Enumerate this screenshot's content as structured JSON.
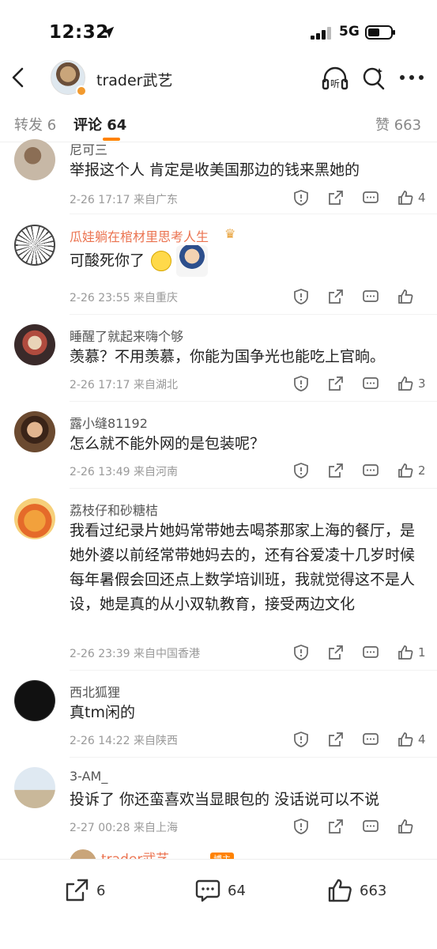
{
  "status_bar": {
    "time": "12:32",
    "network": "5G"
  },
  "nav": {
    "title": "trader武艺",
    "listen_label": "听"
  },
  "tabs": {
    "repost": "转发 6",
    "comments": "评论 64",
    "likes": "赞 663"
  },
  "comments": [
    {
      "name": "尼可三",
      "text": "举报这个人 肯定是收美国那边的钱来黑她的",
      "meta": "2-26 17:17  来自广东",
      "likes": "4"
    },
    {
      "name": "瓜娃躺在棺材里思考人生",
      "text": "可酸死你了",
      "meta": "2-26 23:55  来自重庆",
      "likes": ""
    },
    {
      "name": "睡醒了就起来嗨个够",
      "text": "羡慕？不用羡慕，你能为国争光也能吃上官晌。",
      "meta": "2-26 17:17  来自湖北",
      "likes": "3"
    },
    {
      "name": "露小缝81192",
      "text": "怎么就不能外网的是包装呢？",
      "meta": "2-26 13:49  来自河南",
      "likes": "2"
    },
    {
      "name": "荔枝仔和砂糖桔",
      "text": "我看过纪录片她妈常带她去喝茶那家上海的餐厅，是她外婆以前经常带她妈去的，还有谷爱凌十几岁时候每年暑假会回还点上数学培训班，我就觉得这不是人设，她是真的从小双轨教育，接受两边文化",
      "meta": "2-26 23:39  来自中国香港",
      "likes": "1"
    },
    {
      "name": "西北狐狸",
      "text": "真tm闲的",
      "meta": "2-26 14:22  来自陕西",
      "likes": "4"
    },
    {
      "name": "3-AM_",
      "text": "投诉了 你还蛮喜欢当显眼包的 没话说可以不说",
      "meta": "2-27 00:28  来自上海",
      "likes": ""
    }
  ],
  "peek_reply": {
    "name": "trader武艺",
    "badge": "博主"
  },
  "footer": {
    "reposts": "6",
    "comments": "64",
    "likes": "663"
  },
  "colors": {
    "accent": "#ff8200",
    "orange_name": "#eb7350",
    "meta_gray": "#999999"
  }
}
